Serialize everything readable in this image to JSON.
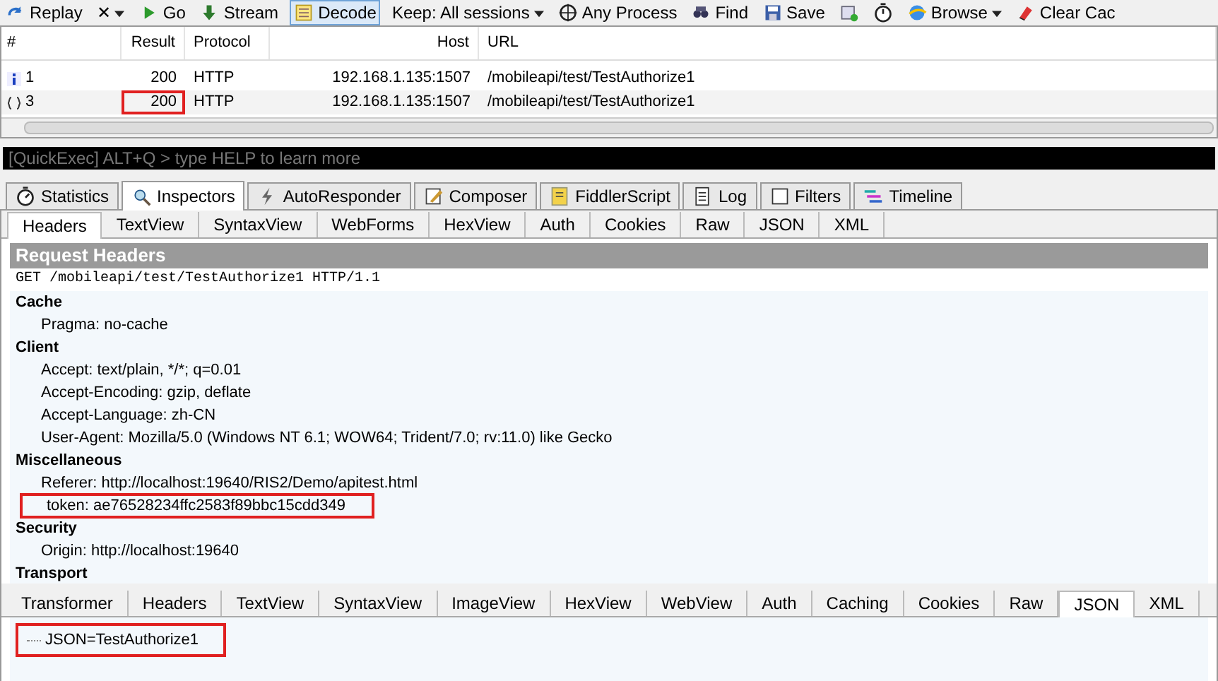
{
  "toolbar": [
    {
      "kind": "replay",
      "label": "Replay",
      "dropdown": false,
      "pressed": false
    },
    {
      "kind": "remove",
      "label": "✕",
      "dropdown": true,
      "pressed": false
    },
    {
      "kind": "go",
      "label": "Go",
      "dropdown": false,
      "pressed": false
    },
    {
      "kind": "stream",
      "label": "Stream",
      "dropdown": false,
      "pressed": false
    },
    {
      "kind": "decode",
      "label": "Decode",
      "dropdown": false,
      "pressed": true
    },
    {
      "kind": "keep",
      "label": "Keep: All sessions",
      "dropdown": true,
      "pressed": false
    },
    {
      "kind": "process",
      "label": "Any Process",
      "dropdown": false,
      "pressed": false
    },
    {
      "kind": "find",
      "label": "Find",
      "dropdown": false,
      "pressed": false
    },
    {
      "kind": "save",
      "label": "Save",
      "dropdown": false,
      "pressed": false
    },
    {
      "kind": "screenshot",
      "dropdown": false,
      "pressed": false
    },
    {
      "kind": "timer",
      "dropdown": false,
      "pressed": false
    },
    {
      "kind": "browse",
      "label": "Browse",
      "dropdown": true,
      "pressed": false
    },
    {
      "kind": "clear",
      "label": "Clear Cac",
      "dropdown": false,
      "pressed": false
    }
  ],
  "sessions": {
    "columns": [
      "#",
      "Result",
      "Protocol",
      "Host",
      "URL"
    ],
    "rows": [
      {
        "kind": "info",
        "number": "1",
        "result": "200",
        "protocol": "HTTP",
        "host": "192.168.1.135:1507",
        "url": "/mobileapi/test/TestAuthorize1",
        "highlighted": false
      },
      {
        "kind": "json",
        "number": "3",
        "result": "200",
        "protocol": "HTTP",
        "host": "192.168.1.135:1507",
        "url": "/mobileapi/test/TestAuthorize1",
        "highlighted": true
      }
    ]
  },
  "quickexec": {
    "placeholder": "[QuickExec] ALT+Q > type HELP to learn more"
  },
  "tabs": [
    {
      "kind": "statistics",
      "label": "Statistics",
      "selected": false
    },
    {
      "kind": "inspectors",
      "label": "Inspectors",
      "selected": true
    },
    {
      "kind": "autoresponder",
      "label": "AutoResponder",
      "selected": false
    },
    {
      "kind": "composer",
      "label": "Composer",
      "selected": false
    },
    {
      "kind": "script",
      "label": "FiddlerScript",
      "selected": false
    },
    {
      "kind": "log",
      "label": "Log",
      "selected": false
    },
    {
      "kind": "filters",
      "label": "Filters",
      "selected": false
    },
    {
      "kind": "timeline",
      "label": "Timeline",
      "selected": false
    }
  ],
  "request_tabs": [
    {
      "label": "Headers",
      "selected": true
    },
    {
      "label": "TextView",
      "selected": false
    },
    {
      "label": "SyntaxView",
      "selected": false
    },
    {
      "label": "WebForms",
      "selected": false
    },
    {
      "label": "HexView",
      "selected": false
    },
    {
      "label": "Auth",
      "selected": false
    },
    {
      "label": "Cookies",
      "selected": false
    },
    {
      "label": "Raw",
      "selected": false
    },
    {
      "label": "JSON",
      "selected": false
    },
    {
      "label": "XML",
      "selected": false
    }
  ],
  "request_headers": {
    "title": "Request Headers",
    "request_line": "GET /mobileapi/test/TestAuthorize1 HTTP/1.1",
    "groups": [
      {
        "name": "Cache",
        "headers": [
          {
            "text": "Pragma: no-cache",
            "highlighted": false
          }
        ]
      },
      {
        "name": "Client",
        "headers": [
          {
            "text": "Accept: text/plain, */*; q=0.01",
            "highlighted": false
          },
          {
            "text": "Accept-Encoding: gzip, deflate",
            "highlighted": false
          },
          {
            "text": "Accept-Language: zh-CN",
            "highlighted": false
          },
          {
            "text": "User-Agent: Mozilla/5.0 (Windows NT 6.1; WOW64; Trident/7.0; rv:11.0) like Gecko",
            "highlighted": false
          }
        ]
      },
      {
        "name": "Miscellaneous",
        "headers": [
          {
            "text": "Referer: http://localhost:19640/RIS2/Demo/apitest.html",
            "highlighted": false
          },
          {
            "text": "token: ae76528234ffc2583f89bbc15cdd349",
            "highlighted": true
          }
        ]
      },
      {
        "name": "Security",
        "headers": [
          {
            "text": "Origin: http://localhost:19640",
            "highlighted": false
          }
        ]
      },
      {
        "name": "Transport"
      }
    ]
  },
  "response_tabs": [
    {
      "label": "Transformer",
      "selected": false
    },
    {
      "label": "Headers",
      "selected": false
    },
    {
      "label": "TextView",
      "selected": false
    },
    {
      "label": "SyntaxView",
      "selected": false
    },
    {
      "label": "ImageView",
      "selected": false
    },
    {
      "label": "HexView",
      "selected": false
    },
    {
      "label": "WebView",
      "selected": false
    },
    {
      "label": "Auth",
      "selected": false
    },
    {
      "label": "Caching",
      "selected": false
    },
    {
      "label": "Cookies",
      "selected": false
    },
    {
      "label": "Raw",
      "selected": false
    },
    {
      "label": "JSON",
      "selected": true
    },
    {
      "label": "XML",
      "selected": false
    }
  ],
  "json_tree": [
    {
      "text": "JSON=TestAuthorize1",
      "highlighted": true
    }
  ]
}
